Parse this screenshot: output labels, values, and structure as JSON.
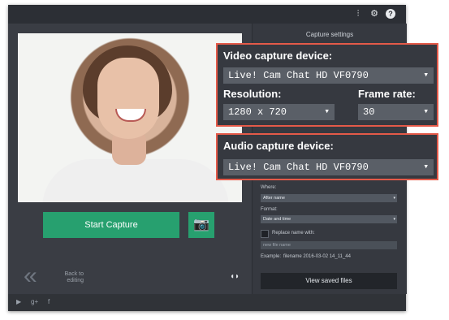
{
  "titlebar": {
    "icons": [
      "sliders-icon",
      "gear-icon",
      "help-icon"
    ]
  },
  "preview": {
    "image": "webcam-preview"
  },
  "left": {
    "start_capture": "Start Capture",
    "camera_icon": "camera-icon",
    "back_label": "Back to editing",
    "audio_icon": "audio-icon"
  },
  "settings": {
    "title": "Capture settings",
    "where_label": "Where:",
    "where_value": "After name",
    "format_label": "Format:",
    "format_value": "Date and time",
    "replace_label": "Replace name with:",
    "new_file_placeholder": "new file name",
    "example_label": "Example:",
    "example_value": "filename 2016-03-02 14_11_44",
    "view_saved_files": "View saved files"
  },
  "callouts": {
    "video": {
      "title": "Video capture device:",
      "device": "Live! Cam Chat HD VF0790",
      "resolution_label": "Resolution:",
      "resolution_value": "1280 x 720",
      "framerate_label": "Frame rate:",
      "framerate_value": "30"
    },
    "audio": {
      "title": "Audio capture device:",
      "device": "Live! Cam Chat HD VF0790"
    }
  },
  "footer": {
    "icons": [
      "youtube-icon",
      "google-plus-icon",
      "facebook-icon"
    ]
  },
  "colors": {
    "accent_green": "#27a06f",
    "callout_red": "#e45a49",
    "panel_dark": "#363940"
  }
}
